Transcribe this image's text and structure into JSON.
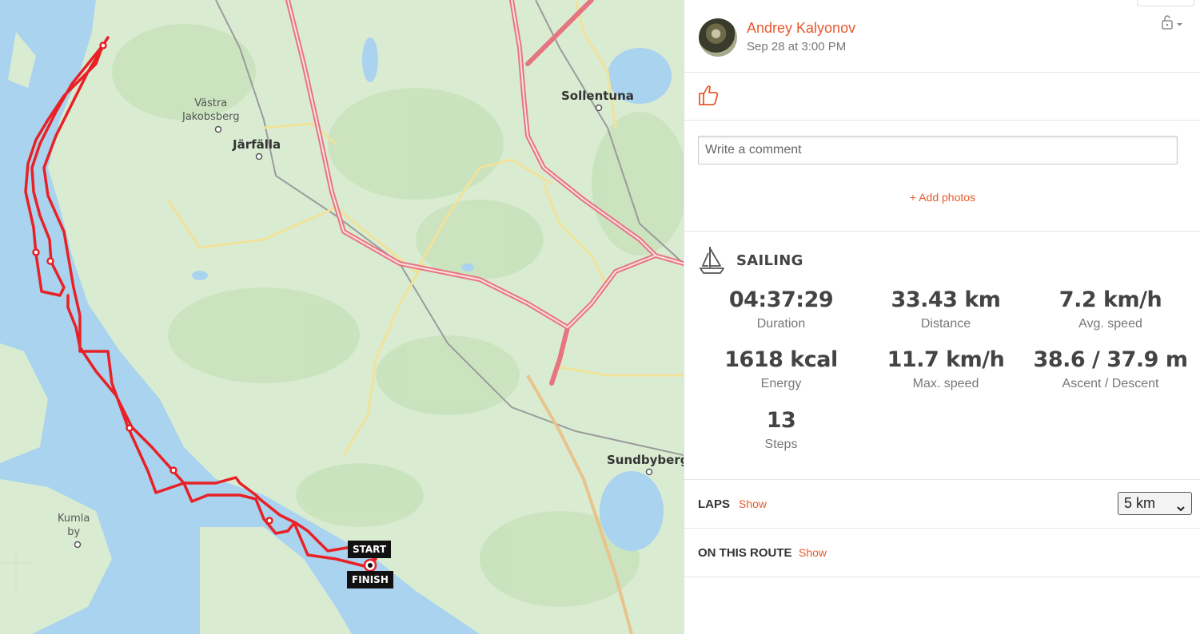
{
  "map": {
    "places": [
      {
        "name": "Västra\nJakobsberg"
      },
      {
        "name": "Järfälla"
      },
      {
        "name": "Sollentuna"
      },
      {
        "name": "Sundbyberg"
      },
      {
        "name": "Kumla\nby"
      }
    ],
    "start_label": "START",
    "finish_label": "FINISH",
    "colors": {
      "route": "#e82126",
      "water": "#a9d3ee",
      "land": "#d9ecd2",
      "motorway": "#e77581",
      "road": "#f2e7a1"
    }
  },
  "header": {
    "user_name": "Andrey Kalyonov",
    "date": "Sep 28 at 3:00 PM",
    "privacy_icon": "lock-icon"
  },
  "actions": {
    "like_icon": "thumbs-up-icon",
    "comment_placeholder": "Write a comment",
    "add_photos": "+ Add photos"
  },
  "workout": {
    "sport": "SAILING",
    "sport_icon": "sailboat-icon",
    "stats": [
      {
        "value": "04:37:29",
        "label": "Duration"
      },
      {
        "value": "33.43 km",
        "label": "Distance"
      },
      {
        "value": "7.2 km/h",
        "label": "Avg. speed"
      },
      {
        "value": "1618 kcal",
        "label": "Energy"
      },
      {
        "value": "11.7 km/h",
        "label": "Max. speed"
      },
      {
        "value": "38.6 / 37.9 m",
        "label": "Ascent / Descent"
      },
      {
        "value": "13",
        "label": "Steps"
      }
    ]
  },
  "laps": {
    "label": "LAPS",
    "link": "Show",
    "selected": "5 km"
  },
  "route": {
    "label": "ON THIS ROUTE",
    "link": "Show"
  },
  "accent_color": "#e8592d"
}
